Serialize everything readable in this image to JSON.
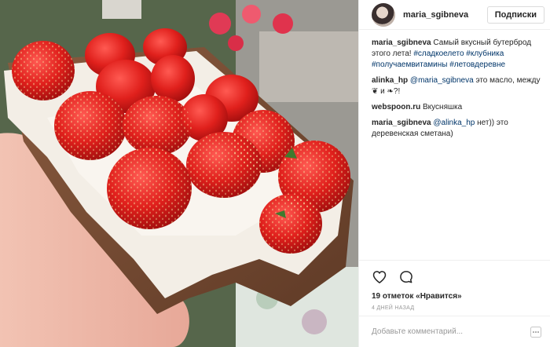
{
  "header": {
    "username": "maria_sgibneva",
    "follow_label": "Подписки"
  },
  "comments": [
    {
      "author": "maria_sgibneva",
      "parts": [
        {
          "text": "Самый вкусный бутерброд этого лета! ",
          "kind": "text"
        },
        {
          "text": "#сладкоелето",
          "kind": "tag"
        },
        {
          "text": " ",
          "kind": "text"
        },
        {
          "text": "#клубника",
          "kind": "tag"
        },
        {
          "text": " ",
          "kind": "text"
        },
        {
          "text": "#получаемвитамины",
          "kind": "tag"
        },
        {
          "text": " ",
          "kind": "text"
        },
        {
          "text": "#летовдеревне",
          "kind": "tag"
        }
      ]
    },
    {
      "author": "alinka_hp",
      "parts": [
        {
          "text": "@maria_sgibneva",
          "kind": "mention"
        },
        {
          "text": " это масло, между ❦ и ❧?!",
          "kind": "text"
        }
      ]
    },
    {
      "author": "webspoon.ru",
      "parts": [
        {
          "text": "Вкусняшка",
          "kind": "text"
        }
      ]
    },
    {
      "author": "maria_sgibneva",
      "parts": [
        {
          "text": "@alinka_hp",
          "kind": "mention"
        },
        {
          "text": " нет)) это деревенская сметана)",
          "kind": "text"
        }
      ]
    }
  ],
  "actions": {
    "like_icon": "heart-icon",
    "comment_icon": "comment-icon"
  },
  "likes": "19 отметок «Нравится»",
  "time": "4 ДНЕЙ НАЗАД",
  "add_comment": {
    "placeholder": "Добавьте комментарий...",
    "more_icon": "more-options-icon"
  },
  "colors": {
    "link": "#003569",
    "text": "#262626",
    "muted": "#999999",
    "border": "#efefef"
  }
}
